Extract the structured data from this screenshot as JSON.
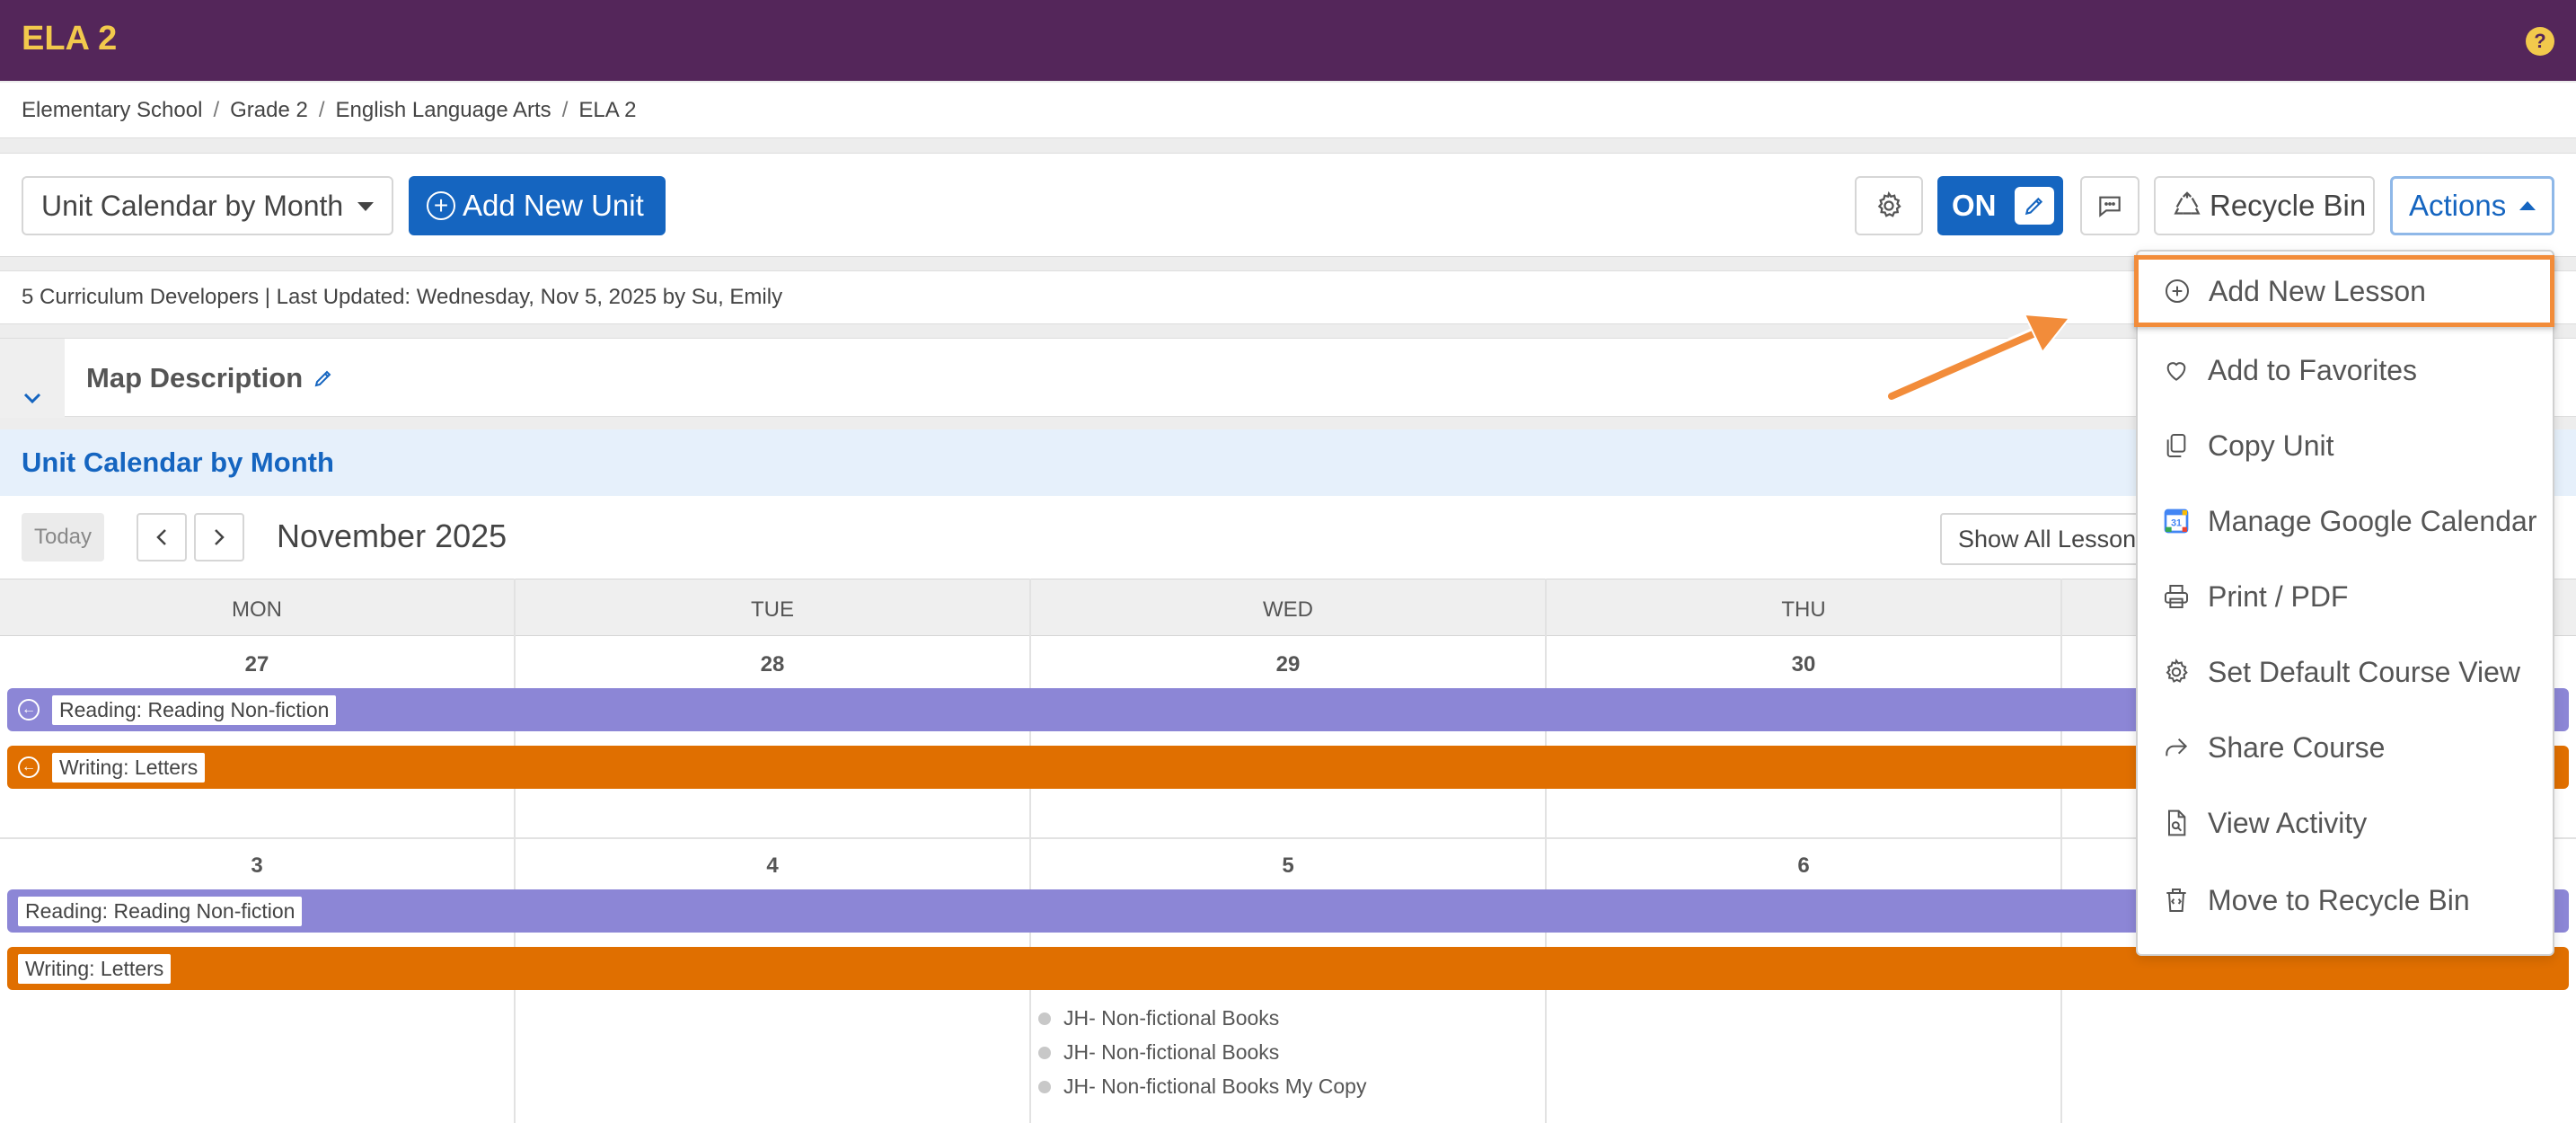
{
  "header": {
    "title": "ELA 2",
    "help_glyph": "?"
  },
  "breadcrumb": [
    "Elementary School",
    "Grade 2",
    "English Language Arts",
    "ELA 2"
  ],
  "toolbar": {
    "view_select": "Unit Calendar by Month",
    "add_unit_label": "Add New Unit",
    "toggle_label": "ON",
    "recycle_label": "Recycle Bin",
    "actions_label": "Actions"
  },
  "meta": {
    "text": "5 Curriculum Developers | Last Updated: Wednesday, Nov 5, 2025 by Su, Emily"
  },
  "map_description": {
    "label": "Map Description"
  },
  "calendar": {
    "header": "Unit Calendar by Month",
    "today_label": "Today",
    "month": "November 2025",
    "filter_label": "Show All Lessons",
    "days": [
      "MON",
      "TUE",
      "WED",
      "THU"
    ],
    "week1": [
      "27",
      "28",
      "29",
      "30"
    ],
    "week2": [
      "3",
      "4",
      "5",
      "6"
    ],
    "units": {
      "reading": "Reading: Reading Non-fiction",
      "writing": "Writing: Letters"
    },
    "lessons": [
      "JH- Non-fictional Books",
      "JH- Non-fictional Books",
      "JH- Non-fictional Books My Copy"
    ]
  },
  "actions_menu": [
    {
      "label": "Add New Lesson",
      "icon": "plus-circle-icon"
    },
    {
      "label": "Add to Favorites",
      "icon": "heart-icon"
    },
    {
      "label": "Copy Unit",
      "icon": "copy-icon"
    },
    {
      "label": "Manage Google Calendar",
      "icon": "google-calendar-icon"
    },
    {
      "label": "Print / PDF",
      "icon": "printer-icon"
    },
    {
      "label": "Set Default Course View",
      "icon": "gear-icon"
    },
    {
      "label": "Share Course",
      "icon": "share-icon"
    },
    {
      "label": "View Activity",
      "icon": "document-search-icon"
    },
    {
      "label": "Move to Recycle Bin",
      "icon": "trash-icon"
    }
  ],
  "colors": {
    "header_bg": "#54265a",
    "title": "#f2c94c",
    "primary": "#1565c0",
    "reading_bar": "#8c86d6",
    "writing_bar": "#e06f00",
    "highlight": "#f28c3a"
  }
}
